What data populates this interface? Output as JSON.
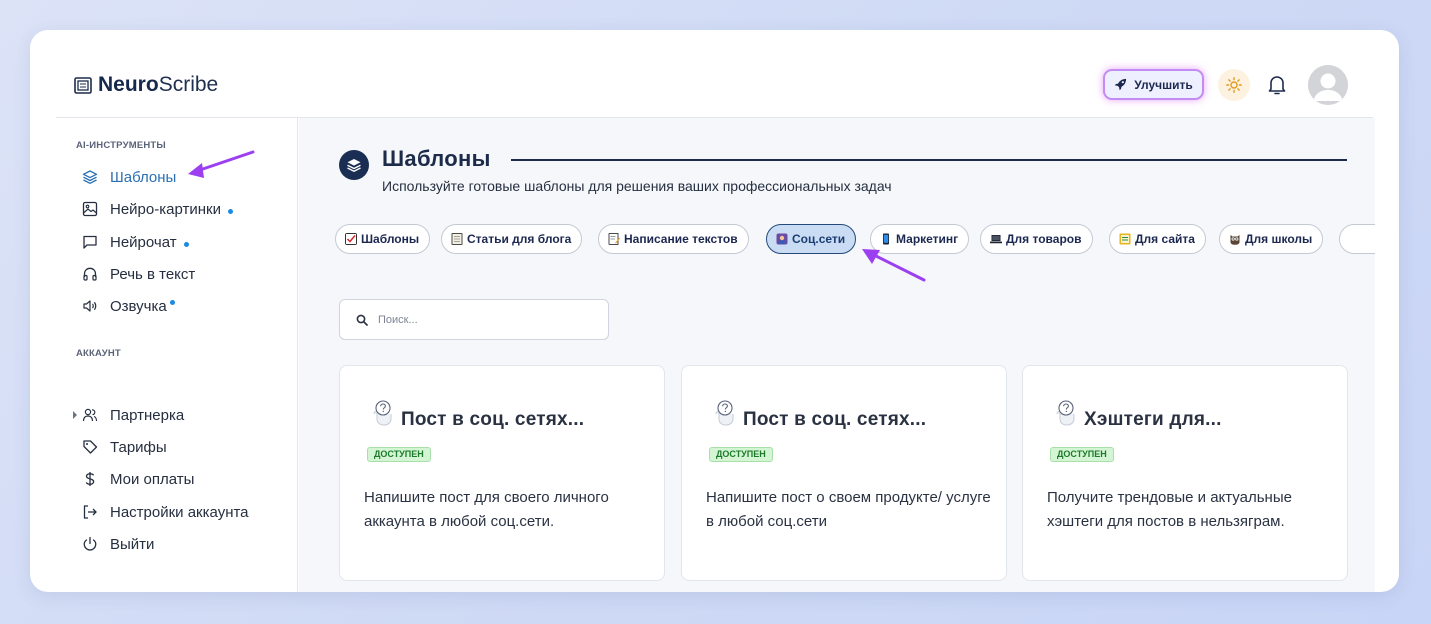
{
  "app": {
    "logo_bold": "Neuro",
    "logo_thin": "Scribe"
  },
  "header": {
    "upgrade_label": "Улучшить"
  },
  "sidebar": {
    "section_tools": "AI-ИНСТРУМЕНТЫ",
    "tools": [
      {
        "label": "Шаблоны",
        "icon": "layers-icon",
        "active": true
      },
      {
        "label": "Нейро-картинки",
        "icon": "image-icon",
        "dot": true
      },
      {
        "label": "Нейрочат",
        "icon": "chat-icon",
        "dot": true
      },
      {
        "label": "Речь в текст",
        "icon": "headphones-icon"
      },
      {
        "label": "Озвучка",
        "icon": "speaker-icon",
        "dot": true
      }
    ],
    "section_account": "АККАУНТ",
    "account": [
      {
        "label": "Партнерка",
        "icon": "users-icon"
      },
      {
        "label": "Тарифы",
        "icon": "tag-icon"
      },
      {
        "label": "Мои оплаты",
        "icon": "dollar-icon"
      },
      {
        "label": "Настройки аккаунта",
        "icon": "login-icon"
      },
      {
        "label": "Выйти",
        "icon": "power-icon"
      }
    ]
  },
  "main": {
    "title": "Шаблоны",
    "subtitle": "Используйте готовые шаблоны для решения ваших профессиональных задач",
    "chips": [
      {
        "label": "Шаблоны",
        "icon": "checkbox-icon"
      },
      {
        "label": "Статьи для блога",
        "icon": "notebook-icon"
      },
      {
        "label": "Написание текстов",
        "icon": "memo-icon"
      },
      {
        "label": "Соц.сети",
        "icon": "selfie-icon",
        "active": true
      },
      {
        "label": "Маркетинг",
        "icon": "phone-icon"
      },
      {
        "label": "Для товаров",
        "icon": "laptop-icon"
      },
      {
        "label": "Для сайта",
        "icon": "ledger-icon"
      },
      {
        "label": "Для школы",
        "icon": "owl-icon"
      }
    ],
    "search_placeholder": "Поиск...",
    "cards": [
      {
        "title": "Пост в соц. сетях...",
        "badge": "ДОСТУПЕН",
        "desc": "Напишите пост для своего личного аккаунта в любой соц.сети."
      },
      {
        "title": "Пост в соц. сетях...",
        "badge": "ДОСТУПЕН",
        "desc": "Напишите пост о своем продукте/ услуге в любой соц.сети"
      },
      {
        "title": "Хэштеги для...",
        "badge": "ДОСТУПЕН",
        "desc": "Получите трендовые и актуальные хэштеги для постов в нельзяграм."
      }
    ]
  },
  "colors": {
    "accent": "#2a6fb3",
    "navy": "#1a2d52",
    "arrow": "#9b3ff0",
    "badge_bg": "#d4f5d4"
  }
}
